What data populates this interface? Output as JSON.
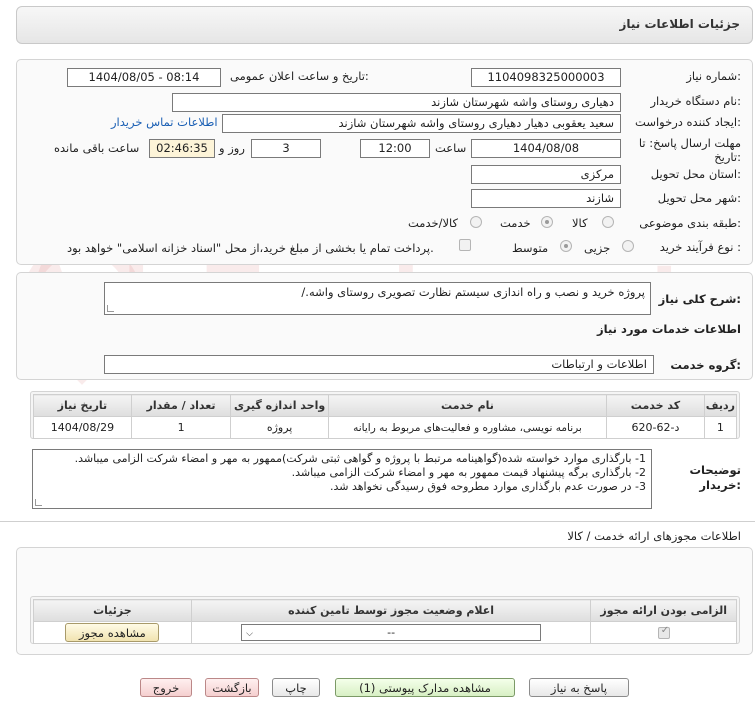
{
  "header": {
    "title": "جزئیات اطلاعات نیاز"
  },
  "info": {
    "need_number_label": "شماره نیاز:",
    "need_number": "1104098325000003",
    "announce_label": "تاریخ و ساعت اعلان عمومی:",
    "announce_value": "1404/08/05 - 08:14",
    "buyer_org_label": "نام دستگاه خریدار:",
    "buyer_org": "دهیاری روستای واشه شهرستان شازند",
    "creator_label": "ایجاد کننده درخواست:",
    "creator": "سعید یعقوبی دهیار دهیاری روستای واشه شهرستان شازند",
    "contact_link": "اطلاعات تماس خریدار",
    "deadline_label": "مهلت ارسال پاسخ: تا تاریخ:",
    "deadline_date": "1404/08/08",
    "time_label": "ساعت",
    "deadline_time": "12:00",
    "days_value": "3",
    "days_label": "روز و",
    "remaining": "02:46:35",
    "remaining_label": "ساعت باقی مانده",
    "province_label": "استان محل تحویل:",
    "province": "مرکزی",
    "city_label": "شهر محل تحویل:",
    "city": "شازند",
    "category_label": "طبقه بندی موضوعی:",
    "category_options": [
      "کالا",
      "خدمت",
      "کالا/خدمت"
    ],
    "category_selected": "خدمت",
    "process_label": "نوع فرآیند خرید :",
    "process_options": [
      "جزیی",
      "متوسط"
    ],
    "process_selected": "متوسط",
    "payment_note": "پرداخت تمام یا بخشی از مبلغ خرید،از محل \"اسناد خزانه اسلامی\" خواهد بود."
  },
  "general": {
    "desc_label": "شرح کلی نیاز:",
    "desc": "پروژه خرید و نصب و راه اندازی سیستم نظارت تصویری روستای واشه./",
    "services_heading": "اطلاعات خدمات مورد نیاز",
    "group_label": "گروه خدمت:",
    "group_value": "اطلاعات و ارتباطات"
  },
  "services_table": {
    "headers": [
      "ردیف",
      "کد خدمت",
      "نام خدمت",
      "واحد اندازه گیری",
      "تعداد / مقدار",
      "تاریخ نیاز"
    ],
    "rows": [
      [
        "1",
        "د-62-620",
        "برنامه نویسی، مشاوره و فعالیت‌های مربوط به رایانه",
        "پروژه",
        "1",
        "1404/08/29"
      ]
    ]
  },
  "buyer_notes": {
    "label": "توضیحات خریدار:",
    "lines": [
      "1- بارگذاری موارد خواسته شده(گواهینامه مرتبط با پروژه و گواهی ثبتی شرکت)ممهور به مهر و امضاء شرکت الزامی میباشد.",
      "2- بارگذاری برگه پیشنهاد قیمت ممهور به مهر و امضاء شرکت الزامی میباشد.",
      "3- در صورت عدم بارگذاری موارد مطروحه فوق رسیدگی نخواهد شد."
    ]
  },
  "permits": {
    "heading": "اطلاعات مجوزهای ارائه خدمت / کالا",
    "headers": [
      "الزامی بودن ارائه مجوز",
      "اعلام وضعیت مجوز توسط تامین کننده",
      "جزئیات"
    ],
    "select_value": "--",
    "view_button": "مشاهده مجوز"
  },
  "footer": {
    "reply": "پاسخ به نیاز",
    "attachments": "مشاهده مدارک پیوستی (1)",
    "print": "چاپ",
    "back": "بازگشت",
    "exit": "خروج"
  },
  "watermark": {
    "text": "AriaTender.net"
  },
  "colors": {
    "link": "#1a5fb4",
    "remaining_bg": "#fdf4d8",
    "accent_green": "#d8f0c4",
    "accent_pink": "#f5cfcf"
  }
}
